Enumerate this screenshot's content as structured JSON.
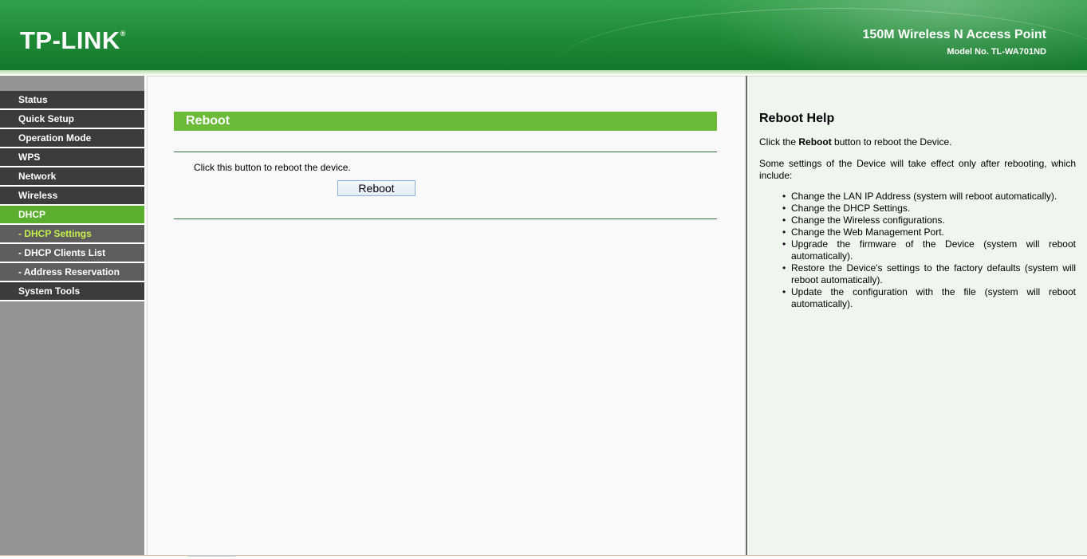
{
  "header": {
    "logo_text": "TP-LINK",
    "logo_mark": "®",
    "product_name": "150M Wireless N Access Point",
    "model_no": "Model No. TL-WA701ND"
  },
  "sidebar": {
    "items": [
      {
        "label": "Status"
      },
      {
        "label": "Quick Setup"
      },
      {
        "label": "Operation Mode"
      },
      {
        "label": "WPS"
      },
      {
        "label": "Network"
      },
      {
        "label": "Wireless"
      },
      {
        "label": "DHCP"
      },
      {
        "label": "- DHCP Settings"
      },
      {
        "label": "- DHCP Clients List"
      },
      {
        "label": "- Address Reservation"
      },
      {
        "label": "System Tools"
      }
    ]
  },
  "main": {
    "title": "Reboot",
    "instruction": "Click this button to reboot the device.",
    "reboot_button": "Reboot"
  },
  "help": {
    "title": "Reboot Help",
    "intro_before": "Click the ",
    "intro_bold": "Reboot",
    "intro_after": " button to reboot the Device.",
    "para2": "Some settings of the Device will take effect only after rebooting, which include:",
    "list": [
      "Change the LAN IP Address (system will reboot automatically).",
      "Change the DHCP Settings.",
      "Change the Wireless configurations.",
      "Change the Web Management Port.",
      "Upgrade the firmware of the Device (system will reboot automatically).",
      "Restore the Device's settings to the factory defaults (system will reboot automatically).",
      "Update the configuration with the file (system will reboot automatically)."
    ]
  },
  "colors": {
    "brand_green": "#1f8a36",
    "accent_green": "#6bbb39",
    "menu_dark": "#3c3c3c",
    "submenu_active_text": "#c5f04a"
  }
}
